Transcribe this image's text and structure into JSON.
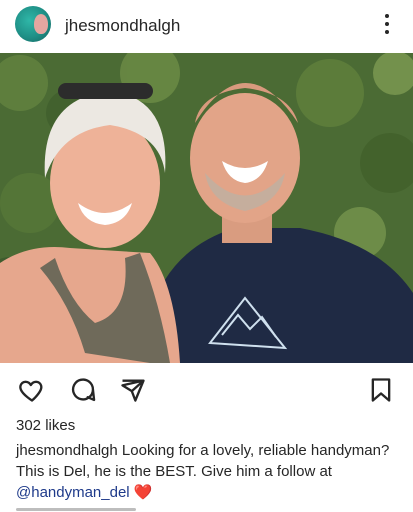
{
  "post": {
    "username": "jhesmondhalgh",
    "likes": "302 likes",
    "caption": {
      "username": "jhesmondhalgh",
      "text": " Looking for a lovely, reliable handyman? This is Del, he is the BEST. Give him a follow at ",
      "mention": "@handyman_del",
      "emoji": "❤️"
    }
  },
  "icons": {
    "more": "more-vertical-icon",
    "like": "heart-outline-icon",
    "comment": "comment-bubble-icon",
    "share": "paper-plane-icon",
    "save": "bookmark-icon"
  },
  "colors": {
    "text": "#262626",
    "mention": "#1e3a8a",
    "heart": "#e0245e"
  }
}
